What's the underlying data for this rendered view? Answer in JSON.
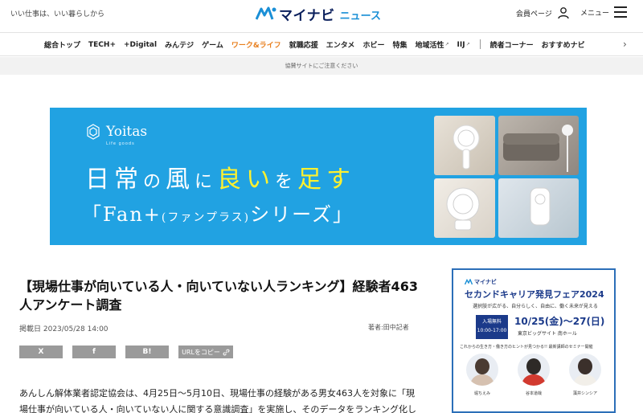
{
  "header": {
    "tagline": "いい仕事は、いい暮らしから",
    "logo_text": "マイナビ",
    "logo_sub": "ニュース",
    "member_label": "会員ページ",
    "menu_label": "メニュー",
    "brand_color": "#0a1f5c",
    "accent_color": "#1a8fd6"
  },
  "nav": {
    "items": [
      "総合トップ",
      "TECH+",
      "+Digital",
      "みんテジ",
      "ゲーム",
      "ワーク&ライフ",
      "就職応援",
      "エンタメ",
      "ホビー",
      "特集",
      "地域活性",
      "IIJ",
      "読者コーナー",
      "おすすめナビ"
    ],
    "active": "ワーク&ライフ",
    "external_items": [
      "地域活性",
      "IIJ"
    ],
    "active_color": "#e87e1c",
    "next_icon": "chevron-right-icon"
  },
  "ad_notice": "協賛サイトにご注意ください",
  "banner": {
    "brand": "Yoitas",
    "brand_sub": "Life goods",
    "headline": [
      "日",
      "常",
      "の",
      "風",
      "に",
      "良",
      "い",
      "を",
      "足",
      "す"
    ],
    "headline_styles": [
      "w",
      "w",
      "s",
      "w",
      "s",
      "y",
      "y",
      "s",
      "y",
      "y"
    ],
    "subline_open": "「Fan+",
    "subline_small": "(ファンプラス)",
    "subline_close": "シリーズ」",
    "background": "#21a2e2",
    "highlight": "#fff12e"
  },
  "article": {
    "title": "【現場仕事が向いている人・向いていない人ランキング】経験者463人アンケート調査",
    "meta": "掲載日 2023/05/28 14:00",
    "author_label": "著者:",
    "author_name": "田中記者",
    "share": {
      "x": "X",
      "facebook": "f",
      "hatena": "B!",
      "copy_url": "URLをコピー"
    },
    "body": "あんしん解体業者認定協会は、4月25日〜5月10日、現場仕事の経験がある男女463人を対象に「現場仕事が向いている人・向いていない人に関する意識調査」を実施し、そのデータをランキング化し"
  },
  "side_ad": {
    "logo": "マイナビ",
    "title": "セカンドキャリア発見フェア2024",
    "subtitle": "選択肢が広がる、自分らしく、自由に、働く未来が見える",
    "free_label": "入場無料",
    "time": "10:00-17:00",
    "dates": "10/25(金)〜27(日)",
    "venue": "東京ビッグサイト 南ホール",
    "tagline": "これからの生き方・働き方のヒントが見つかる!! 最新講師のセミナー開催",
    "speakers": [
      "堀ちえみ",
      "谷本道哉",
      "藻井シンシア"
    ],
    "border_color": "#2c6fb8",
    "title_color": "#1b3a8a"
  }
}
